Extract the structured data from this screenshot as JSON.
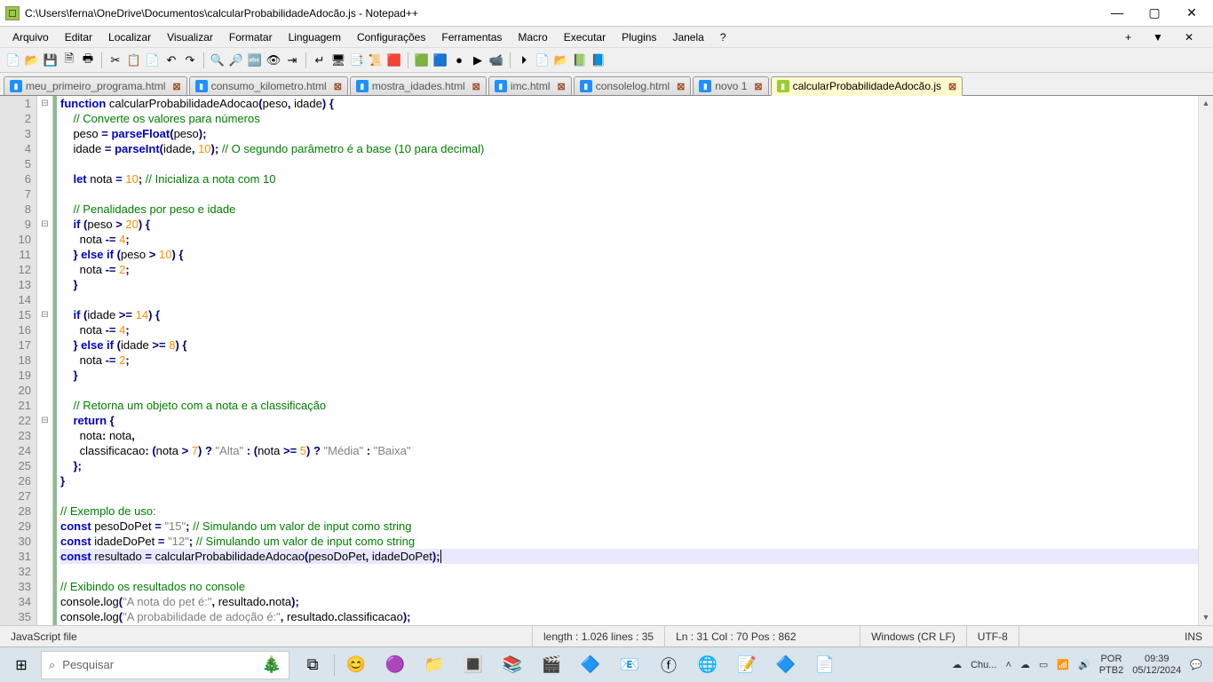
{
  "window": {
    "title": "C:\\Users\\ferna\\OneDrive\\Documentos\\calcularProbabilidadeAdocão.js - Notepad++"
  },
  "menu": {
    "items": [
      "Arquivo",
      "Editar",
      "Localizar",
      "Visualizar",
      "Formatar",
      "Linguagem",
      "Configurações",
      "Ferramentas",
      "Macro",
      "Executar",
      "Plugins",
      "Janela",
      "?"
    ]
  },
  "toolbar": {
    "icons": [
      "📄",
      "📂",
      "💾",
      "🗎",
      "🖶",
      "✂",
      "📋",
      "📄",
      "↶",
      "↷",
      "🔍",
      "🔎",
      "🔤",
      "👁",
      "⇥",
      "↵",
      "🖥",
      "📑",
      "📜",
      "🟥",
      "🟩",
      "🟦",
      "●",
      "▶",
      "📹",
      "⏵",
      "📄",
      "📂",
      "📗",
      "📘"
    ]
  },
  "tabs": [
    {
      "label": "meu_primeiro_programa.html",
      "icon": "html"
    },
    {
      "label": "consumo_kilometro.html",
      "icon": "html"
    },
    {
      "label": "mostra_idades.html",
      "icon": "html"
    },
    {
      "label": "imc.html",
      "icon": "html"
    },
    {
      "label": "consolelog.html",
      "icon": "html"
    },
    {
      "label": "novo 1",
      "icon": "txt"
    },
    {
      "label": "calcularProbabilidadeAdocão.js",
      "icon": "js",
      "active": true
    }
  ],
  "code": {
    "lines": [
      [
        {
          "t": "kw",
          "v": "function"
        },
        {
          "t": "id",
          "v": " calcularProbabilidadeAdocao"
        },
        {
          "t": "op",
          "v": "("
        },
        {
          "t": "id",
          "v": "peso"
        },
        {
          "t": "op",
          "v": ","
        },
        {
          "t": "id",
          "v": " idade"
        },
        {
          "t": "op",
          "v": ") {"
        }
      ],
      [
        {
          "t": "sp",
          "v": "    "
        },
        {
          "t": "cm",
          "v": "// Converte os valores para números"
        }
      ],
      [
        {
          "t": "sp",
          "v": "    "
        },
        {
          "t": "id",
          "v": "peso "
        },
        {
          "t": "op",
          "v": "="
        },
        {
          "t": "id",
          "v": " "
        },
        {
          "t": "kw",
          "v": "parseFloat"
        },
        {
          "t": "op",
          "v": "("
        },
        {
          "t": "id",
          "v": "peso"
        },
        {
          "t": "op",
          "v": ");"
        }
      ],
      [
        {
          "t": "sp",
          "v": "    "
        },
        {
          "t": "id",
          "v": "idade "
        },
        {
          "t": "op",
          "v": "="
        },
        {
          "t": "id",
          "v": " "
        },
        {
          "t": "kw",
          "v": "parseInt"
        },
        {
          "t": "op",
          "v": "("
        },
        {
          "t": "id",
          "v": "idade"
        },
        {
          "t": "op",
          "v": ", "
        },
        {
          "t": "nm",
          "v": "10"
        },
        {
          "t": "op",
          "v": "); "
        },
        {
          "t": "cm",
          "v": "// O segundo parâmetro é a base (10 para decimal)"
        }
      ],
      [],
      [
        {
          "t": "sp",
          "v": "    "
        },
        {
          "t": "kw",
          "v": "let"
        },
        {
          "t": "id",
          "v": " nota "
        },
        {
          "t": "op",
          "v": "="
        },
        {
          "t": "id",
          "v": " "
        },
        {
          "t": "nm",
          "v": "10"
        },
        {
          "t": "op",
          "v": "; "
        },
        {
          "t": "cm",
          "v": "// Inicializa a nota com 10"
        }
      ],
      [],
      [
        {
          "t": "sp",
          "v": "    "
        },
        {
          "t": "cm",
          "v": "// Penalidades por peso e idade"
        }
      ],
      [
        {
          "t": "sp",
          "v": "    "
        },
        {
          "t": "kw",
          "v": "if"
        },
        {
          "t": "id",
          "v": " "
        },
        {
          "t": "op",
          "v": "("
        },
        {
          "t": "id",
          "v": "peso "
        },
        {
          "t": "op",
          "v": ">"
        },
        {
          "t": "id",
          "v": " "
        },
        {
          "t": "nm",
          "v": "20"
        },
        {
          "t": "op",
          "v": ") {"
        }
      ],
      [
        {
          "t": "sp",
          "v": "      "
        },
        {
          "t": "id",
          "v": "nota "
        },
        {
          "t": "op",
          "v": "-="
        },
        {
          "t": "id",
          "v": " "
        },
        {
          "t": "nm",
          "v": "4"
        },
        {
          "t": "op",
          "v": ";"
        }
      ],
      [
        {
          "t": "sp",
          "v": "    "
        },
        {
          "t": "op",
          "v": "}"
        },
        {
          "t": "id",
          "v": " "
        },
        {
          "t": "kw",
          "v": "else if"
        },
        {
          "t": "id",
          "v": " "
        },
        {
          "t": "op",
          "v": "("
        },
        {
          "t": "id",
          "v": "peso "
        },
        {
          "t": "op",
          "v": ">"
        },
        {
          "t": "id",
          "v": " "
        },
        {
          "t": "nm",
          "v": "10"
        },
        {
          "t": "op",
          "v": ") {"
        }
      ],
      [
        {
          "t": "sp",
          "v": "      "
        },
        {
          "t": "id",
          "v": "nota "
        },
        {
          "t": "op",
          "v": "-="
        },
        {
          "t": "id",
          "v": " "
        },
        {
          "t": "nm",
          "v": "2"
        },
        {
          "t": "op",
          "v": ";"
        }
      ],
      [
        {
          "t": "sp",
          "v": "    "
        },
        {
          "t": "op",
          "v": "}"
        }
      ],
      [],
      [
        {
          "t": "sp",
          "v": "    "
        },
        {
          "t": "kw",
          "v": "if"
        },
        {
          "t": "id",
          "v": " "
        },
        {
          "t": "op",
          "v": "("
        },
        {
          "t": "id",
          "v": "idade "
        },
        {
          "t": "op",
          "v": ">="
        },
        {
          "t": "id",
          "v": " "
        },
        {
          "t": "nm",
          "v": "14"
        },
        {
          "t": "op",
          "v": ") {"
        }
      ],
      [
        {
          "t": "sp",
          "v": "      "
        },
        {
          "t": "id",
          "v": "nota "
        },
        {
          "t": "op",
          "v": "-="
        },
        {
          "t": "id",
          "v": " "
        },
        {
          "t": "nm",
          "v": "4"
        },
        {
          "t": "op",
          "v": ";"
        }
      ],
      [
        {
          "t": "sp",
          "v": "    "
        },
        {
          "t": "op",
          "v": "}"
        },
        {
          "t": "id",
          "v": " "
        },
        {
          "t": "kw",
          "v": "else if"
        },
        {
          "t": "id",
          "v": " "
        },
        {
          "t": "op",
          "v": "("
        },
        {
          "t": "id",
          "v": "idade "
        },
        {
          "t": "op",
          "v": ">="
        },
        {
          "t": "id",
          "v": " "
        },
        {
          "t": "nm",
          "v": "8"
        },
        {
          "t": "op",
          "v": ") {"
        }
      ],
      [
        {
          "t": "sp",
          "v": "      "
        },
        {
          "t": "id",
          "v": "nota "
        },
        {
          "t": "op",
          "v": "-="
        },
        {
          "t": "id",
          "v": " "
        },
        {
          "t": "nm",
          "v": "2"
        },
        {
          "t": "op",
          "v": ";"
        }
      ],
      [
        {
          "t": "sp",
          "v": "    "
        },
        {
          "t": "op",
          "v": "}"
        }
      ],
      [],
      [
        {
          "t": "sp",
          "v": "    "
        },
        {
          "t": "cm",
          "v": "// Retorna um objeto com a nota e a classificação"
        }
      ],
      [
        {
          "t": "sp",
          "v": "    "
        },
        {
          "t": "kw",
          "v": "return"
        },
        {
          "t": "id",
          "v": " "
        },
        {
          "t": "op",
          "v": "{"
        }
      ],
      [
        {
          "t": "sp",
          "v": "      "
        },
        {
          "t": "id",
          "v": "nota"
        },
        {
          "t": "op",
          "v": ":"
        },
        {
          "t": "id",
          "v": " nota"
        },
        {
          "t": "op",
          "v": ","
        }
      ],
      [
        {
          "t": "sp",
          "v": "      "
        },
        {
          "t": "id",
          "v": "classificacao"
        },
        {
          "t": "op",
          "v": ": ("
        },
        {
          "t": "id",
          "v": "nota "
        },
        {
          "t": "op",
          "v": ">"
        },
        {
          "t": "id",
          "v": " "
        },
        {
          "t": "nm",
          "v": "7"
        },
        {
          "t": "op",
          "v": ") ? "
        },
        {
          "t": "st",
          "v": "\"Alta\""
        },
        {
          "t": "op",
          "v": " : ("
        },
        {
          "t": "id",
          "v": "nota "
        },
        {
          "t": "op",
          "v": ">="
        },
        {
          "t": "id",
          "v": " "
        },
        {
          "t": "nm",
          "v": "5"
        },
        {
          "t": "op",
          "v": ") ? "
        },
        {
          "t": "st",
          "v": "\"Média\""
        },
        {
          "t": "op",
          "v": " : "
        },
        {
          "t": "st",
          "v": "\"Baixa\""
        }
      ],
      [
        {
          "t": "sp",
          "v": "    "
        },
        {
          "t": "op",
          "v": "};"
        }
      ],
      [
        {
          "t": "op",
          "v": "}"
        }
      ],
      [],
      [
        {
          "t": "cm",
          "v": "// Exemplo de uso:"
        }
      ],
      [
        {
          "t": "kw",
          "v": "const"
        },
        {
          "t": "id",
          "v": " pesoDoPet "
        },
        {
          "t": "op",
          "v": "="
        },
        {
          "t": "id",
          "v": " "
        },
        {
          "t": "st",
          "v": "\"15\""
        },
        {
          "t": "op",
          "v": "; "
        },
        {
          "t": "cm",
          "v": "// Simulando um valor de input como string"
        }
      ],
      [
        {
          "t": "kw",
          "v": "const"
        },
        {
          "t": "id",
          "v": " idadeDoPet "
        },
        {
          "t": "op",
          "v": "="
        },
        {
          "t": "id",
          "v": " "
        },
        {
          "t": "st",
          "v": "\"12\""
        },
        {
          "t": "op",
          "v": "; "
        },
        {
          "t": "cm",
          "v": "// Simulando um valor de input como string"
        }
      ],
      [
        {
          "t": "kw",
          "v": "const"
        },
        {
          "t": "id",
          "v": " resultado "
        },
        {
          "t": "op",
          "v": "="
        },
        {
          "t": "id",
          "v": " calcularProbabilidadeAdocao"
        },
        {
          "t": "op",
          "v": "("
        },
        {
          "t": "id",
          "v": "pesoDoPet"
        },
        {
          "t": "op",
          "v": ","
        },
        {
          "t": "id",
          "v": " idadeDoPet"
        },
        {
          "t": "op",
          "v": ");"
        }
      ],
      [],
      [
        {
          "t": "cm",
          "v": "// Exibindo os resultados no console"
        }
      ],
      [
        {
          "t": "id",
          "v": "console"
        },
        {
          "t": "op",
          "v": "."
        },
        {
          "t": "id",
          "v": "log"
        },
        {
          "t": "op",
          "v": "("
        },
        {
          "t": "st",
          "v": "\"A nota do pet é:\""
        },
        {
          "t": "op",
          "v": ","
        },
        {
          "t": "id",
          "v": " resultado"
        },
        {
          "t": "op",
          "v": "."
        },
        {
          "t": "id",
          "v": "nota"
        },
        {
          "t": "op",
          "v": ");"
        }
      ],
      [
        {
          "t": "id",
          "v": "console"
        },
        {
          "t": "op",
          "v": "."
        },
        {
          "t": "id",
          "v": "log"
        },
        {
          "t": "op",
          "v": "("
        },
        {
          "t": "st",
          "v": "\"A probabilidade de adoção é:\""
        },
        {
          "t": "op",
          "v": ","
        },
        {
          "t": "id",
          "v": " resultado"
        },
        {
          "t": "op",
          "v": "."
        },
        {
          "t": "id",
          "v": "classificacao"
        },
        {
          "t": "op",
          "v": ");"
        }
      ]
    ],
    "fold": {
      "1": "⊟",
      "9": "⊟",
      "15": "⊟",
      "22": "⊟"
    },
    "highlighted_line": 31
  },
  "status": {
    "filetype": "JavaScript file",
    "length": "length : 1.026    lines : 35",
    "pos": "Ln : 31    Col : 70    Pos : 862",
    "eol": "Windows (CR LF)",
    "encoding": "UTF-8",
    "ins": "INS"
  },
  "taskbar": {
    "search_placeholder": "Pesquisar",
    "weather": "Chu...",
    "lang1": "POR",
    "lang2": "PTB2",
    "time": "09:39",
    "date": "05/12/2024"
  }
}
